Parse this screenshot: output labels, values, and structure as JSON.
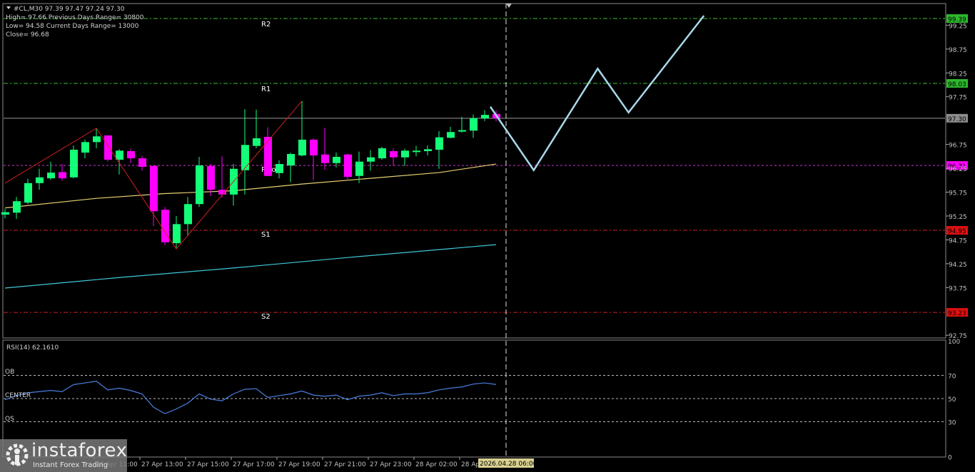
{
  "header": {
    "symbol_line": "#CL,M30  97.39 97.47 97.24 97.30",
    "high_line": "High= 97.66   Previous Days Range= 30800",
    "low_line": "Low= 94.58   Current Days Range= 13000",
    "close_line": "Close= 96.68"
  },
  "levels": [
    {
      "label": "R2",
      "price": 99.39,
      "tag": "99.39",
      "color": "#3cbf3c",
      "tag_bg": "#2db82d",
      "tag_fg": "#000000"
    },
    {
      "label": "R1",
      "price": 98.03,
      "tag": "98.03",
      "color": "#3cbf3c",
      "tag_bg": "#2db82d",
      "tag_fg": "#000000"
    },
    {
      "label": "",
      "price": 97.3,
      "tag": "97.30",
      "color": "#9a9a9a",
      "tag_bg": "#8c8c8c",
      "tag_fg": "#000000"
    },
    {
      "label": "Pivot",
      "price": 96.31,
      "tag": "96.31",
      "color": "#cc33cc",
      "tag_bg": "#ff00ff",
      "tag_fg": "#000000"
    },
    {
      "label": "S1",
      "price": 94.95,
      "tag": "94.95",
      "color": "#d02020",
      "tag_bg": "#e01010",
      "tag_fg": "#000000"
    },
    {
      "label": "S2",
      "price": 93.23,
      "tag": "93.23",
      "color": "#d02020",
      "tag_bg": "#e01010",
      "tag_fg": "#000000"
    }
  ],
  "price_axis": [
    "99.25",
    "98.75",
    "98.25",
    "97.75",
    "96.75",
    "96.25",
    "95.75",
    "95.25",
    "94.75",
    "94.25",
    "93.75",
    "92.75"
  ],
  "rsi": {
    "title": "RSI(14) 62.1610",
    "ob_label": "OB",
    "center_label": "CENTER",
    "os_label": "OS",
    "axis": [
      "100",
      "70",
      "50",
      "30",
      "0"
    ],
    "values": [
      49,
      52.5,
      55,
      56,
      57,
      56,
      62,
      63.5,
      65,
      57.5,
      59,
      57,
      54,
      42.5,
      37,
      41,
      46,
      54,
      49.5,
      48,
      54,
      58,
      58.5,
      51,
      52.5,
      54,
      56.5,
      53,
      52,
      53,
      49,
      52,
      53,
      55,
      52.5,
      54,
      54,
      55,
      57.5,
      59,
      60,
      62.5,
      63.5,
      62.16
    ]
  },
  "time_axis": [
    {
      "label": "27 Apr 11:00",
      "bar": 8
    },
    {
      "label": "27 Apr 13:00",
      "bar": 12
    },
    {
      "label": "27 Apr 15:00",
      "bar": 16
    },
    {
      "label": "27 Apr 17:00",
      "bar": 20
    },
    {
      "label": "27 Apr 19:00",
      "bar": 24
    },
    {
      "label": "27 Apr 21:00",
      "bar": 28
    },
    {
      "label": "27 Apr 23:00",
      "bar": 32
    },
    {
      "label": "28 Apr 02:00",
      "bar": 36
    },
    {
      "label": "28 Apr 04:00",
      "bar": 40
    }
  ],
  "cursor_time": "2026.04.28 06:00",
  "logo": {
    "name": "instaforex",
    "tagline": "Instant Forex Trading"
  },
  "colors": {
    "bull": "#14ff78",
    "bear": "#ff00ff",
    "ma_fast": "#e8d070",
    "ma_slow": "#40c8d8",
    "zigzag": "#d02020",
    "forecast": "#a8d8ea",
    "rsi": "#4a80e0"
  },
  "chart_data": {
    "type": "candlestick",
    "ylim": [
      92.6,
      99.6
    ],
    "candles": [
      [
        95.28,
        95.4,
        95.2,
        95.33
      ],
      [
        95.32,
        95.65,
        95.19,
        95.56
      ],
      [
        95.53,
        96.03,
        95.5,
        95.94
      ],
      [
        95.94,
        96.24,
        95.8,
        96.06
      ],
      [
        96.04,
        96.39,
        96.01,
        96.16
      ],
      [
        96.17,
        96.34,
        95.99,
        96.04
      ],
      [
        96.06,
        96.73,
        96.04,
        96.64
      ],
      [
        96.58,
        96.85,
        96.46,
        96.8
      ],
      [
        96.8,
        97.09,
        96.67,
        96.92
      ],
      [
        96.94,
        96.94,
        96.39,
        96.43
      ],
      [
        96.43,
        96.65,
        96.12,
        96.62
      ],
      [
        96.61,
        96.66,
        96.36,
        96.46
      ],
      [
        96.46,
        96.51,
        96.2,
        96.28
      ],
      [
        96.3,
        96.3,
        95.04,
        95.35
      ],
      [
        95.38,
        95.44,
        94.64,
        94.7
      ],
      [
        94.68,
        95.25,
        94.58,
        95.08
      ],
      [
        95.08,
        95.65,
        94.85,
        95.5
      ],
      [
        95.5,
        96.49,
        95.44,
        96.31
      ],
      [
        96.3,
        96.34,
        95.67,
        95.8
      ],
      [
        95.8,
        96.5,
        95.64,
        95.7
      ],
      [
        95.7,
        96.34,
        95.47,
        96.24
      ],
      [
        96.21,
        97.49,
        95.7,
        96.74
      ],
      [
        96.72,
        97.48,
        96.67,
        96.88
      ],
      [
        96.91,
        97.11,
        96.09,
        96.09
      ],
      [
        96.15,
        96.42,
        96.04,
        96.34
      ],
      [
        96.31,
        96.58,
        95.96,
        96.55
      ],
      [
        96.52,
        97.66,
        96.5,
        96.85
      ],
      [
        96.85,
        96.88,
        96.0,
        96.52
      ],
      [
        96.54,
        97.1,
        96.22,
        96.36
      ],
      [
        96.36,
        96.58,
        96.27,
        96.49
      ],
      [
        96.54,
        96.56,
        96.02,
        96.07
      ],
      [
        96.09,
        96.6,
        95.94,
        96.39
      ],
      [
        96.39,
        96.63,
        96.2,
        96.48
      ],
      [
        96.46,
        96.7,
        96.43,
        96.67
      ],
      [
        96.61,
        96.67,
        96.3,
        96.48
      ],
      [
        96.48,
        96.66,
        96.3,
        96.62
      ],
      [
        96.6,
        96.72,
        96.5,
        96.62
      ],
      [
        96.61,
        96.73,
        96.52,
        96.65
      ],
      [
        96.64,
        97.03,
        96.24,
        96.9
      ],
      [
        96.89,
        97.12,
        96.88,
        97.01
      ],
      [
        97.02,
        97.33,
        97.0,
        97.05
      ],
      [
        97.04,
        97.38,
        96.89,
        97.3
      ],
      [
        97.3,
        97.47,
        97.24,
        97.37
      ],
      [
        97.39,
        97.47,
        97.24,
        97.3
      ]
    ],
    "ma_fast": [
      [
        0,
        95.42
      ],
      [
        8,
        95.62
      ],
      [
        14,
        95.72
      ],
      [
        20,
        95.78
      ],
      [
        26,
        95.92
      ],
      [
        32,
        96.04
      ],
      [
        38,
        96.16
      ],
      [
        43,
        96.34
      ]
    ],
    "ma_slow": [
      [
        0,
        93.74
      ],
      [
        10,
        93.96
      ],
      [
        20,
        94.16
      ],
      [
        30,
        94.38
      ],
      [
        43,
        94.65
      ]
    ],
    "zigzag": [
      [
        0,
        95.94
      ],
      [
        8,
        97.09
      ],
      [
        15,
        94.56
      ],
      [
        26,
        97.66
      ]
    ],
    "forecast": [
      [
        42.5,
        97.54
      ],
      [
        46.3,
        96.21
      ],
      [
        51.9,
        98.34
      ],
      [
        54.6,
        97.42
      ],
      [
        61.2,
        99.45
      ]
    ]
  }
}
